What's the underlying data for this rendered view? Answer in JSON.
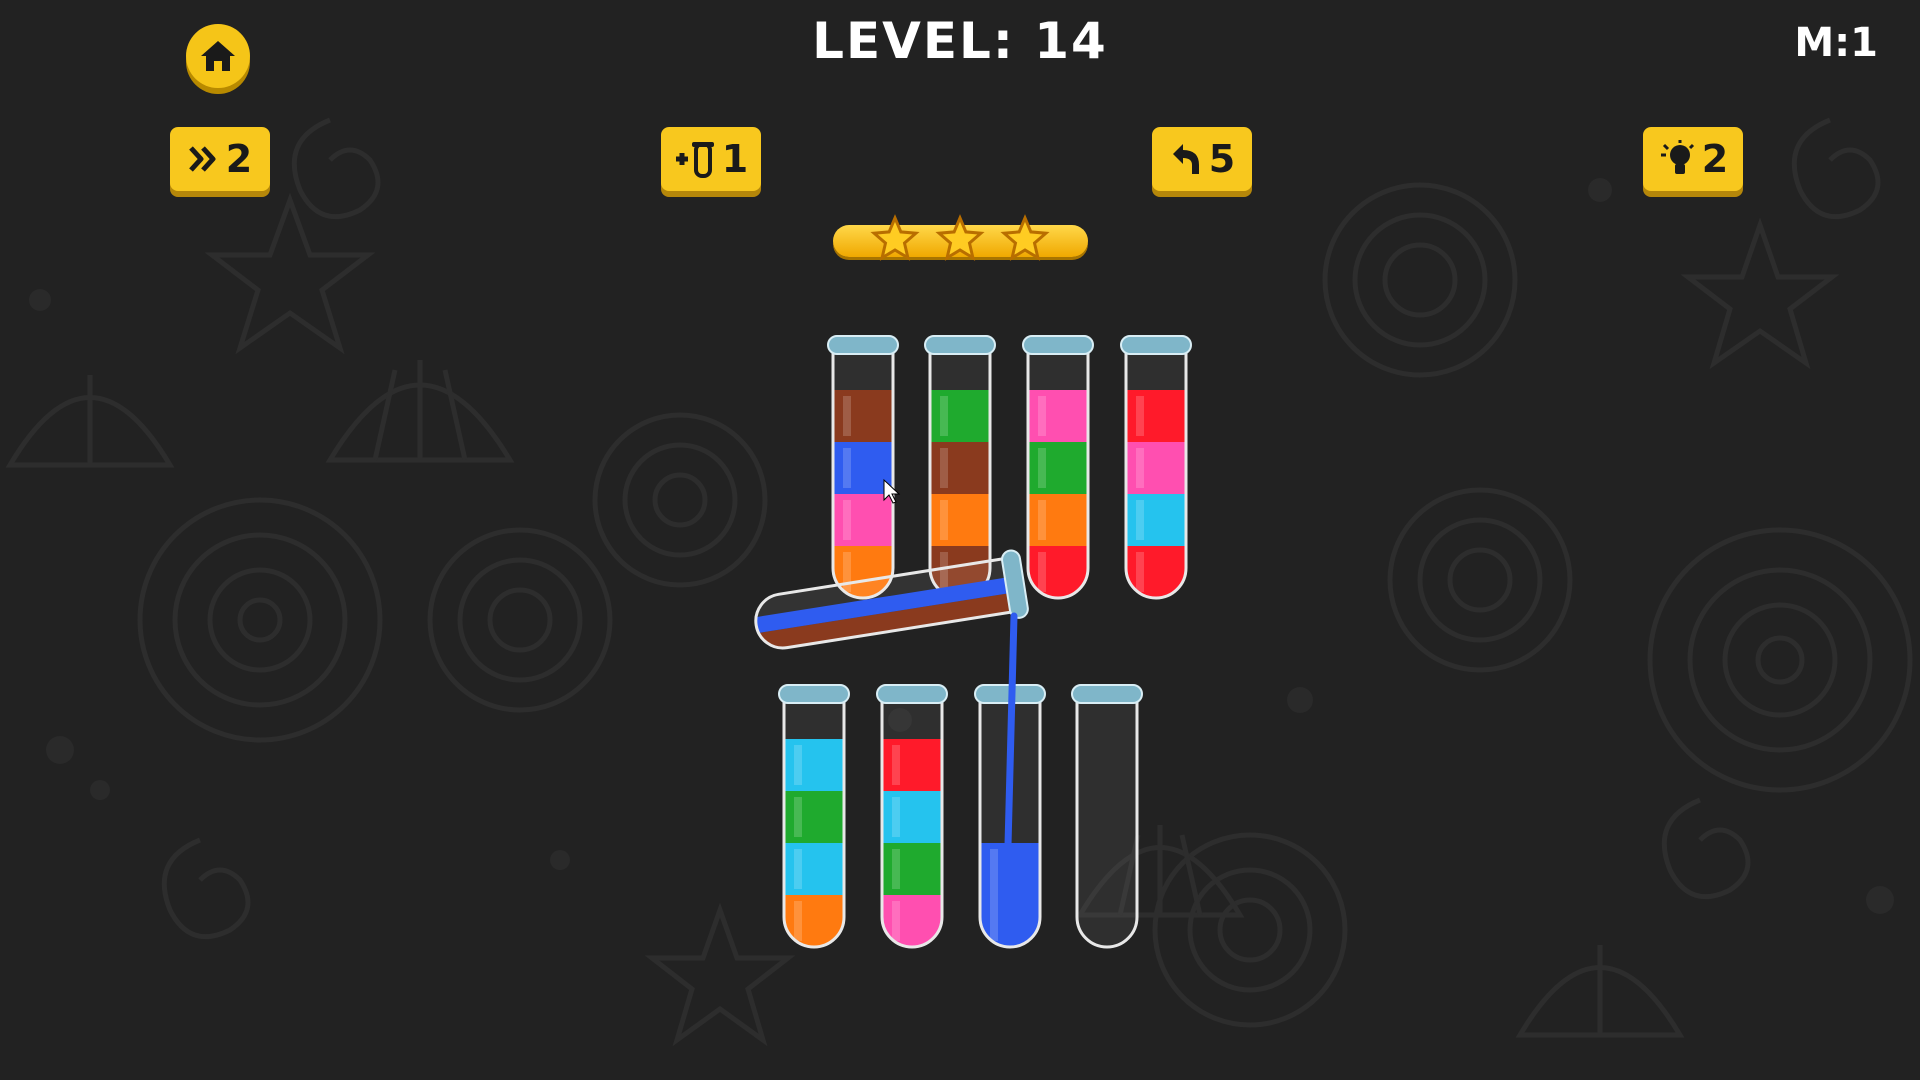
{
  "hud": {
    "level_text": "LEVEL: 14",
    "moves_text": "M:1"
  },
  "powerups": {
    "skip": {
      "icon": "double-chevron-icon",
      "count": "2"
    },
    "add_tube": {
      "icon": "plus-tube-icon",
      "count": "1"
    },
    "undo": {
      "icon": "undo-arrow-icon",
      "count": "5"
    },
    "hint": {
      "icon": "lightbulb-icon",
      "count": "2"
    }
  },
  "rating": {
    "stars": 3,
    "max": 3
  },
  "colors": {
    "brown": "#8a3a1e",
    "blue": "#2f5cf0",
    "pink": "#ff4fb0",
    "orange": "#ff7a10",
    "green": "#1faa2e",
    "red": "#ff1a2a",
    "cyan": "#25c3ee",
    "accent": "#f8c81e",
    "background": "#222222"
  },
  "tubes_top": [
    {
      "layers": [
        "orange",
        "pink",
        "blue",
        "brown"
      ]
    },
    {
      "layers": [
        "brown",
        "orange",
        "brown",
        "green"
      ]
    },
    {
      "layers": [
        "red",
        "orange",
        "green",
        "pink"
      ]
    },
    {
      "layers": [
        "red",
        "cyan",
        "pink",
        "red"
      ]
    }
  ],
  "tubes_bottom": [
    {
      "layers": [
        "orange",
        "cyan",
        "green",
        "cyan"
      ]
    },
    {
      "layers": [
        "pink",
        "green",
        "cyan",
        "red"
      ]
    },
    {
      "layers": [
        "blue"
      ],
      "fill_units": 2
    },
    {
      "layers": []
    }
  ],
  "pouring_tube": {
    "layers": [
      "brown",
      "blue"
    ],
    "pouring_color": "blue"
  }
}
